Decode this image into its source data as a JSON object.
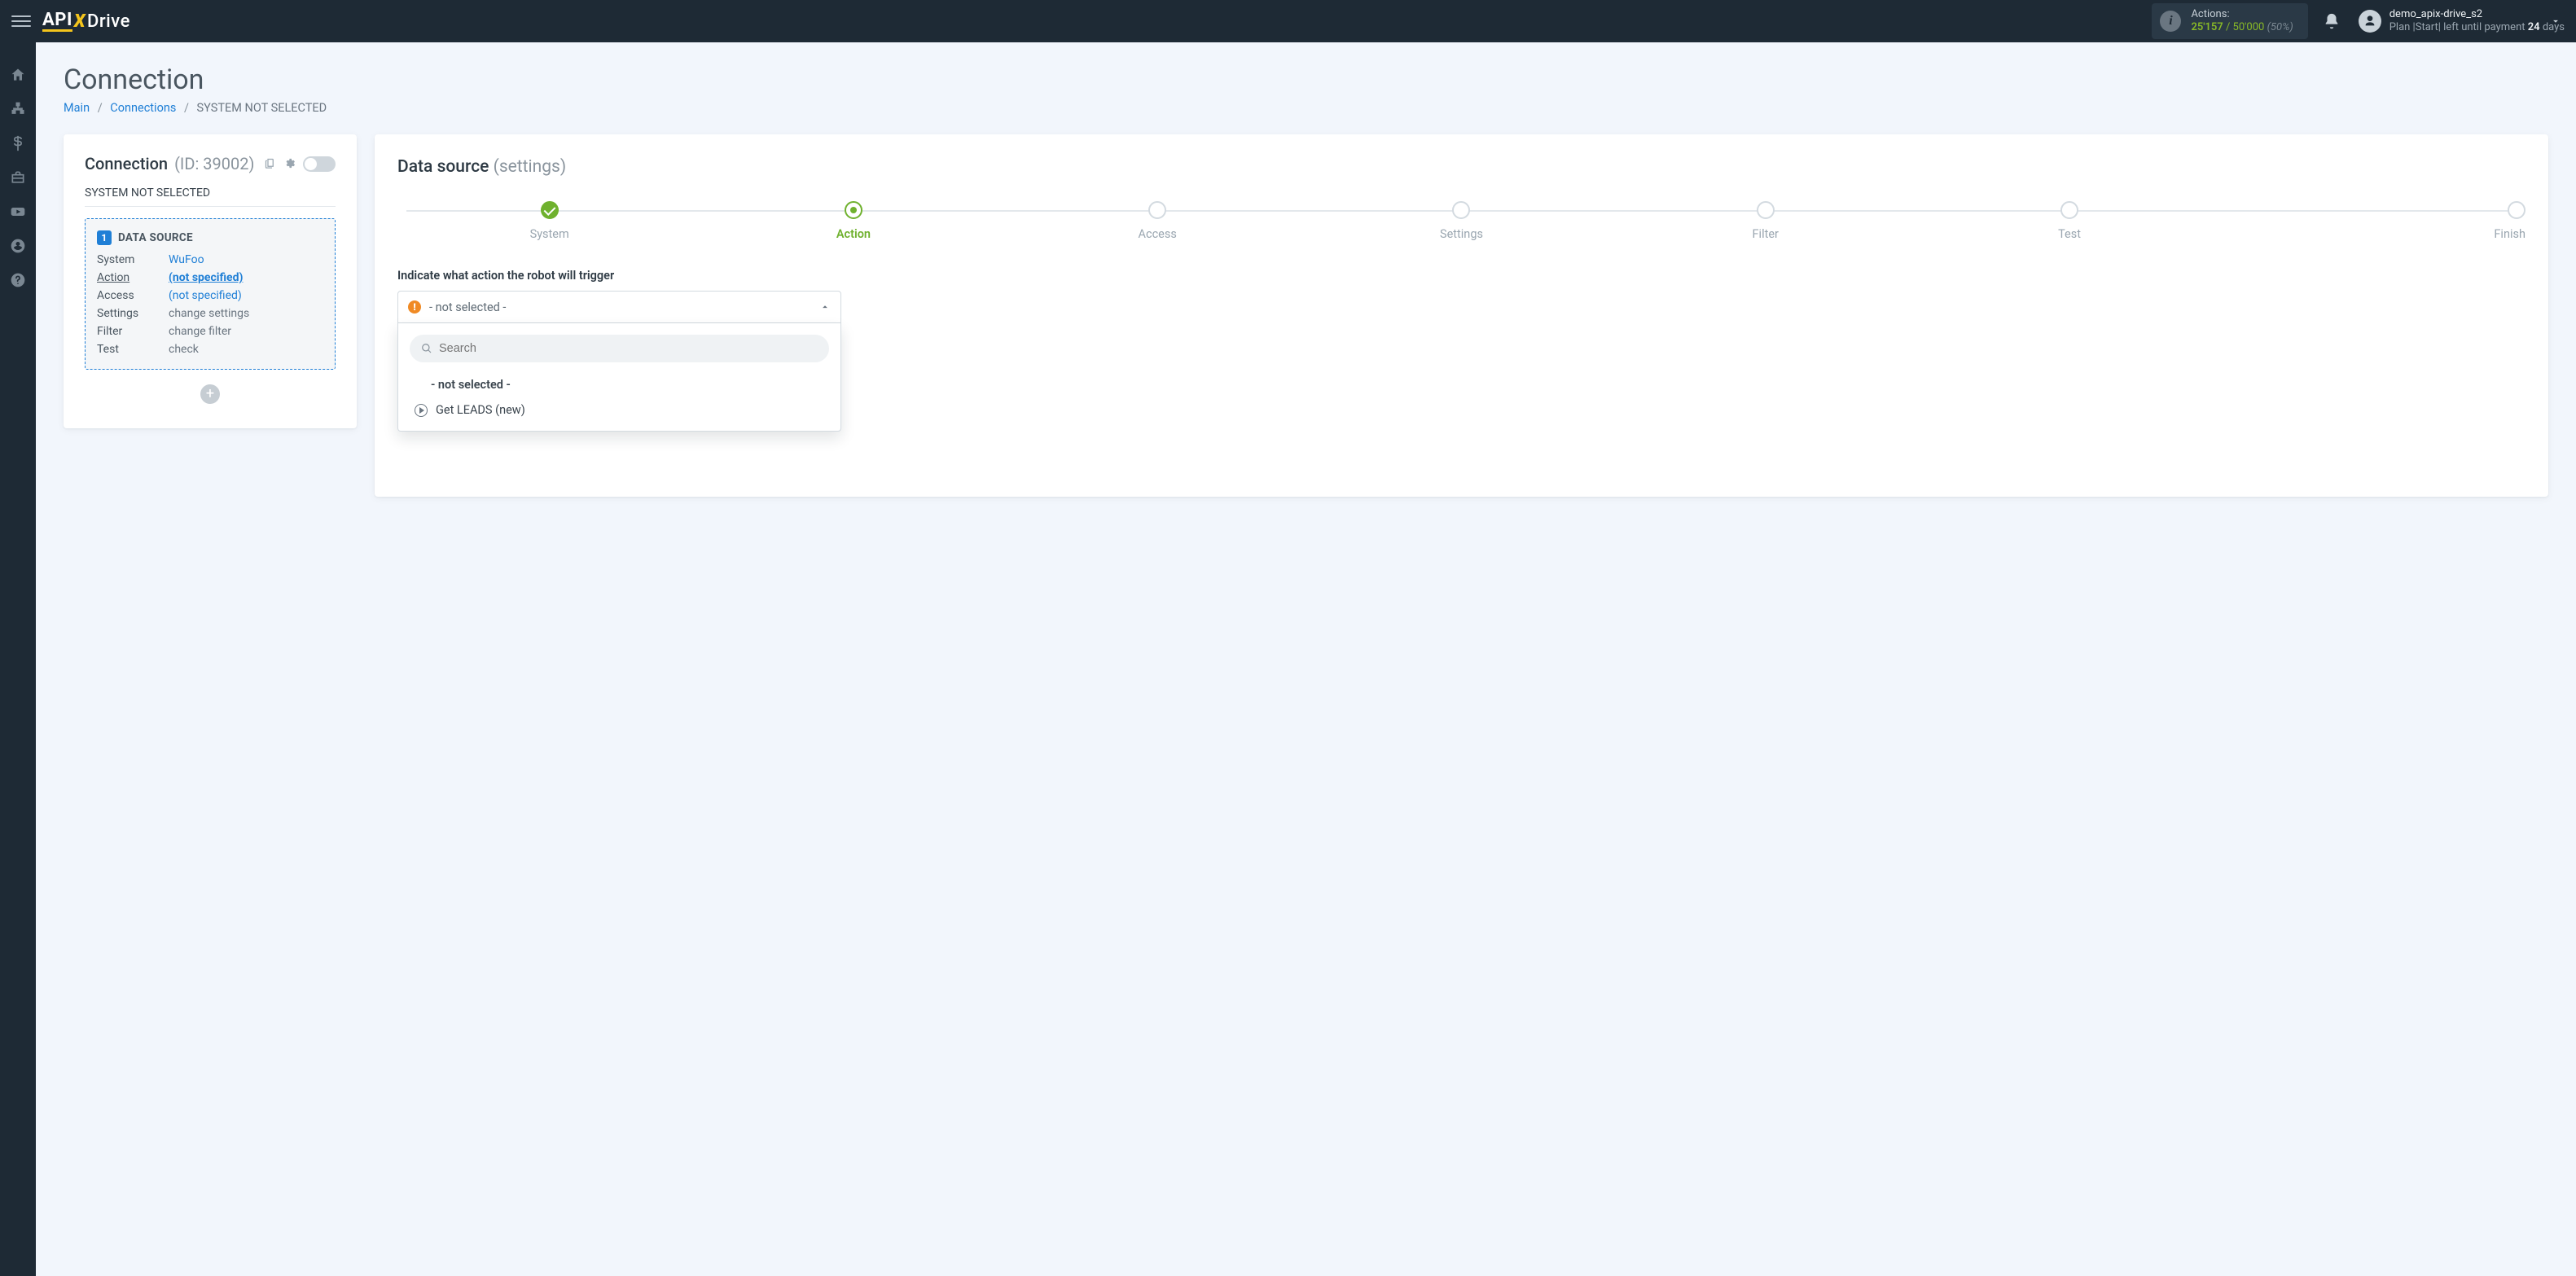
{
  "header": {
    "logo_api": "API",
    "logo_x": "X",
    "logo_drive": "Drive",
    "actions_label": "Actions:",
    "actions_used": "25'157",
    "actions_sep": " / ",
    "actions_total": "50'000",
    "actions_pct": "(50%)",
    "user_name": "demo_apix-drive_s2",
    "user_plan_prefix": "Plan |Start|  left until payment ",
    "user_plan_days": "24",
    "user_plan_suffix": " days"
  },
  "page": {
    "title": "Connection",
    "crumb_main": "Main",
    "crumb_connections": "Connections",
    "crumb_current": "SYSTEM NOT SELECTED"
  },
  "left": {
    "heading": "Connection",
    "heading_sub": "(ID: 39002)",
    "subhead": "SYSTEM NOT SELECTED",
    "ds_badge": "1",
    "ds_title": "DATA SOURCE",
    "rows": {
      "system_k": "System",
      "system_v": "WuFoo",
      "action_k": "Action",
      "action_v": "(not specified)",
      "access_k": "Access",
      "access_v": "(not specified)",
      "settings_k": "Settings",
      "settings_v": "change settings",
      "filter_k": "Filter",
      "filter_v": "change filter",
      "test_k": "Test",
      "test_v": "check"
    }
  },
  "right": {
    "heading": "Data source",
    "heading_sub": "(settings)",
    "steps": {
      "system": "System",
      "action": "Action",
      "access": "Access",
      "settings": "Settings",
      "filter": "Filter",
      "test": "Test",
      "finish": "Finish"
    },
    "prompt": "Indicate what action the robot will trigger",
    "select_value": "- not selected -",
    "search_placeholder": "Search",
    "opt_placeholder": "- not selected -",
    "opt_get_leads": "Get LEADS (new)"
  }
}
